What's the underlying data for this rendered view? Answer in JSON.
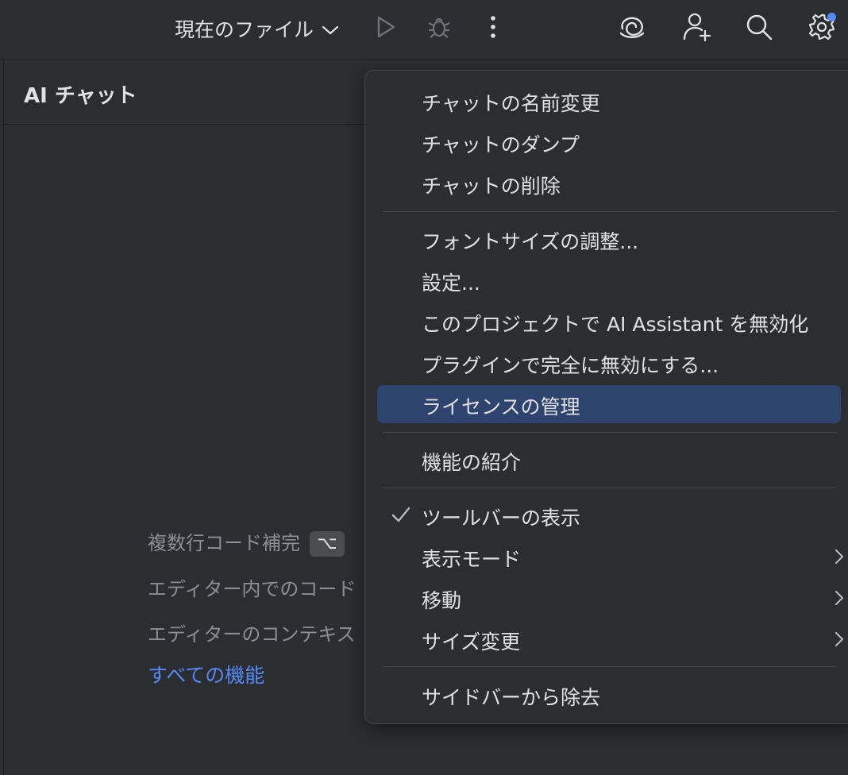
{
  "toolbar": {
    "run_config_label": "現在のファイル",
    "icons": [
      "chevron-down-icon",
      "run-icon",
      "debug-icon",
      "more-vertical-icon",
      "ai-assistant-icon",
      "add-user-icon",
      "search-icon",
      "settings-icon"
    ]
  },
  "panel": {
    "title": "AI チャット",
    "features": [
      {
        "label": "複数行コード補完",
        "key": "⌥"
      },
      {
        "label": "エディター内でのコード"
      },
      {
        "label": "エディターのコンテキス"
      }
    ],
    "all_features_link": "すべての機能"
  },
  "colors": {
    "background": "#2b2d30",
    "menu_selected": "#2e436e",
    "link": "#548af7",
    "notification_dot": "#548af7"
  },
  "menu": {
    "items": [
      {
        "label": "チャットの名前変更"
      },
      {
        "label": "チャットのダンプ"
      },
      {
        "label": "チャットの削除"
      },
      {
        "label": "フォントサイズの調整..."
      },
      {
        "label": "設定..."
      },
      {
        "label": "このプロジェクトで AI Assistant を無効化"
      },
      {
        "label": "プラグインで完全に無効にする..."
      },
      {
        "label": "ライセンスの管理",
        "selected": true
      },
      {
        "label": "機能の紹介"
      },
      {
        "label": "ツールバーの表示",
        "checked": true
      },
      {
        "label": "表示モード",
        "submenu": true
      },
      {
        "label": "移動",
        "submenu": true
      },
      {
        "label": "サイズ変更",
        "submenu": true
      },
      {
        "label": "サイドバーから除去"
      }
    ]
  }
}
